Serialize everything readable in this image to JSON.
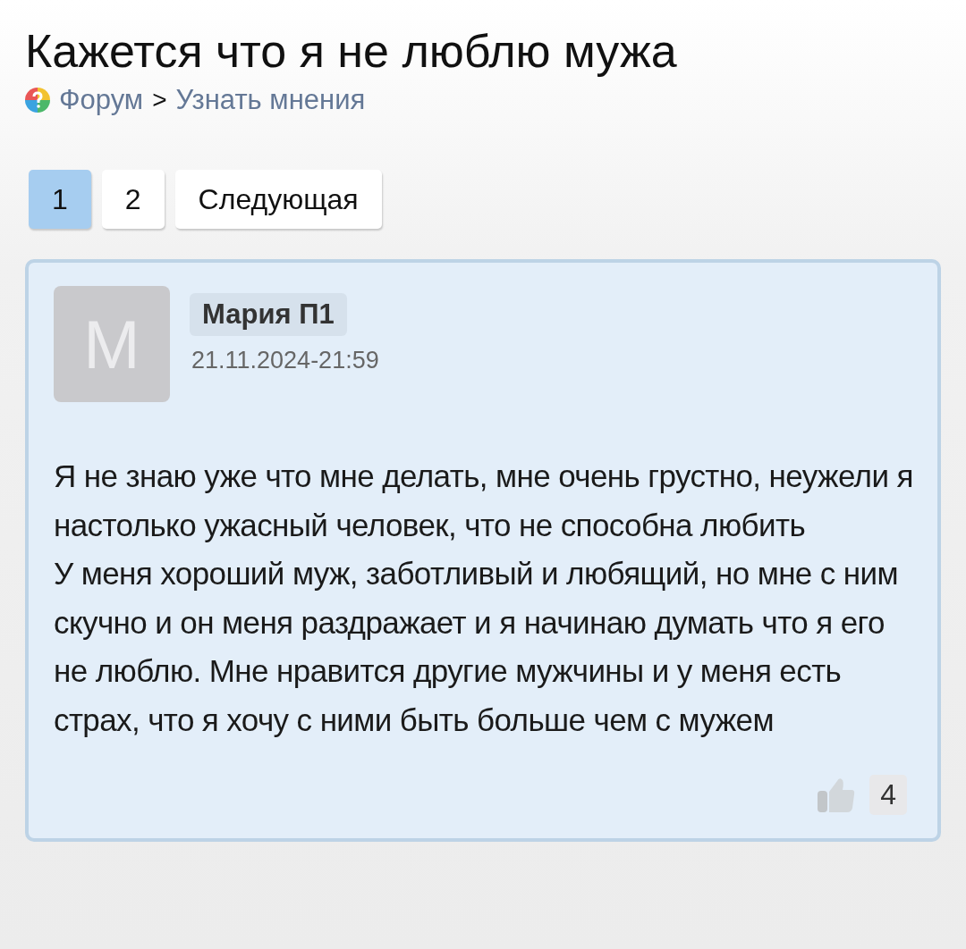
{
  "title": "Кажется что я не люблю мужа",
  "breadcrumb": {
    "items": [
      "Форум",
      "Узнать мнения"
    ],
    "separator": ">"
  },
  "pagination": [
    {
      "label": "1",
      "selected": true
    },
    {
      "label": "2",
      "selected": false
    },
    {
      "label": "Следующая",
      "selected": false
    }
  ],
  "post": {
    "avatar_letter": "М",
    "author": "Мария П1",
    "date": "21.11.2024-21:59",
    "paragraphs": [
      "Я не знаю уже что мне делать, мне очень грустно, неужели я настолько ужасный человек, что не способна любить",
      "У меня хороший муж, заботливый и любящий, но мне с ним скучно и он меня раздражает и я начинаю думать что я его не люблю. Мне нравится другие мужчины и у меня есть страх, что я хочу с ними быть больше чем с мужем"
    ],
    "likes": "4"
  }
}
